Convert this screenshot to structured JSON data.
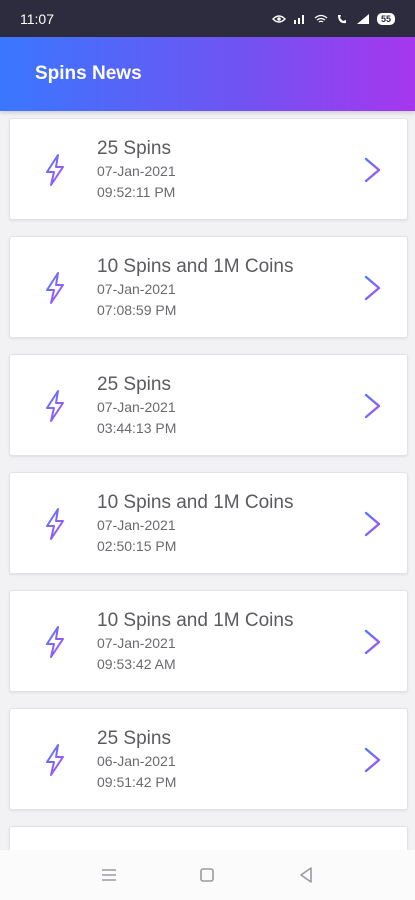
{
  "status": {
    "time": "11:07",
    "battery": "55",
    "icons": [
      "eye-icon",
      "signal-icon",
      "wifi-icon",
      "call-icon",
      "cell-signal-icon",
      "battery-icon"
    ]
  },
  "app": {
    "title": "Spins News"
  },
  "items": [
    {
      "title": "25 Spins",
      "date": "07-Jan-2021",
      "time": "09:52:11 PM"
    },
    {
      "title": "10 Spins and 1M Coins",
      "date": "07-Jan-2021",
      "time": "07:08:59 PM"
    },
    {
      "title": "25 Spins",
      "date": "07-Jan-2021",
      "time": "03:44:13 PM"
    },
    {
      "title": "10 Spins and 1M Coins",
      "date": "07-Jan-2021",
      "time": "02:50:15 PM"
    },
    {
      "title": "10 Spins and 1M Coins",
      "date": "07-Jan-2021",
      "time": "09:53:42 AM"
    },
    {
      "title": "25 Spins",
      "date": "06-Jan-2021",
      "time": "09:51:42 PM"
    }
  ],
  "colors": {
    "app_bar_start": "#3a77ff",
    "app_bar_end": "#a637ee",
    "icon_blue": "#4f7bff",
    "icon_purple": "#b24ff0"
  },
  "nav": {
    "icons": [
      "menu-icon",
      "home-icon",
      "back-icon"
    ]
  }
}
